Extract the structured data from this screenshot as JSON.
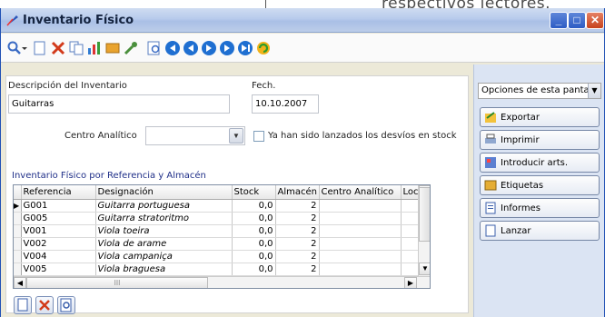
{
  "background": {
    "caption": "respectivos lectores."
  },
  "window": {
    "title": "Inventario Físico"
  },
  "toolbar": {
    "icons": [
      "search-icon",
      "new-doc-icon",
      "delete-icon",
      "copy-icon",
      "chart-icon",
      "label-icon",
      "tools-icon",
      "preview-icon",
      "nav-first-icon",
      "nav-prev-icon",
      "nav-next-icon",
      "nav-last-icon",
      "refresh-icon"
    ]
  },
  "form": {
    "description_label": "Descripción del Inventario",
    "description_value": "Guitarras",
    "date_label": "Fech.",
    "date_value": "10.10.2007",
    "center_label": "Centro Analítico",
    "center_value": "",
    "deviation_label": "Ya han sido lanzados los desvíos en stock"
  },
  "grid": {
    "title": "Inventario Físico por Referencia y Almacén",
    "columns": [
      "Referencia",
      "Designación",
      "Stock",
      "Almacén",
      "Centro Analítico",
      "Local"
    ],
    "rows": [
      {
        "ref": "G001",
        "des": "Guitarra portuguesa",
        "stock": "0,0",
        "alm": "2",
        "centro": "",
        "local": ""
      },
      {
        "ref": "G005",
        "des": "Guitarra stratoritmo",
        "stock": "0,0",
        "alm": "2",
        "centro": "",
        "local": ""
      },
      {
        "ref": "V001",
        "des": "Viola toeira",
        "stock": "0,0",
        "alm": "2",
        "centro": "",
        "local": ""
      },
      {
        "ref": "V002",
        "des": "Viola de arame",
        "stock": "0,0",
        "alm": "2",
        "centro": "",
        "local": ""
      },
      {
        "ref": "V004",
        "des": "Viola campaniça",
        "stock": "0,0",
        "alm": "2",
        "centro": "",
        "local": ""
      },
      {
        "ref": "V005",
        "des": "Viola braguesa",
        "stock": "0,0",
        "alm": "2",
        "centro": "",
        "local": ""
      }
    ],
    "hscroll_grip": "III"
  },
  "sidepanel": {
    "options_label": "Opciones de esta pantalla",
    "actions": [
      "Exportar",
      "Imprimir",
      "Introducir arts.",
      "Etiquetas",
      "Informes",
      "Lanzar"
    ]
  }
}
